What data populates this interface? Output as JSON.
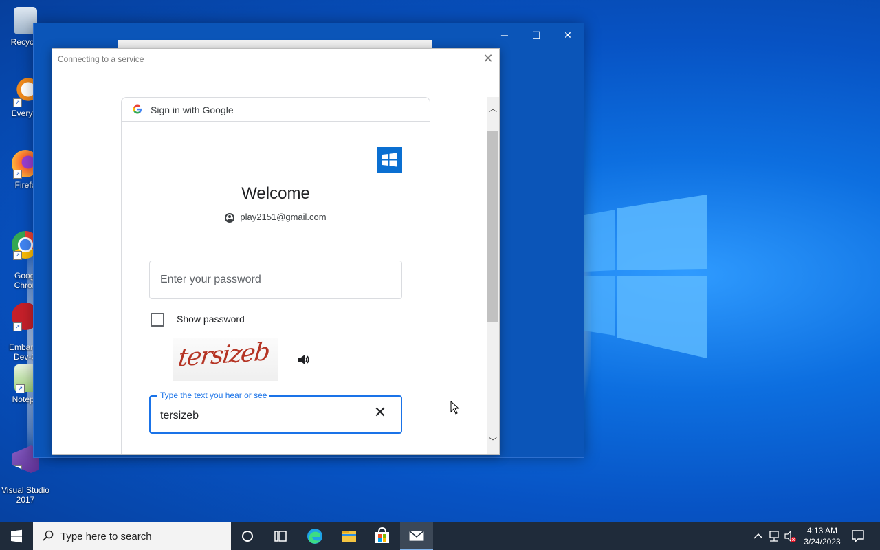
{
  "desktop": {
    "icons": [
      {
        "label": "Recycle",
        "icon": "recycle-bin-icon"
      },
      {
        "label": "Everyth",
        "icon": "everything-search-icon"
      },
      {
        "label": "Firefo",
        "icon": "firefox-icon"
      },
      {
        "label": "Googl\nChron",
        "icon": "chrome-icon"
      },
      {
        "label": "Embarca\nDev-C",
        "icon": "devcpp-icon"
      },
      {
        "label": "Notepa",
        "icon": "notepad-icon"
      },
      {
        "label": "Visual Studio\n2017",
        "icon": "visual-studio-icon"
      }
    ]
  },
  "dialog": {
    "title": "Connecting to a service",
    "google_header": "Sign in with Google",
    "welcome": "Welcome",
    "account_email": "play2151@gmail.com",
    "password_placeholder": "Enter your password",
    "show_password_label": "Show password",
    "show_password_checked": false,
    "captcha_image_text": "tersizeb",
    "captcha_field_label": "Type the text you hear or see",
    "captcha_field_value": "tersizeb"
  },
  "taskbar": {
    "search_placeholder": "Type here to search",
    "time": "4:13 AM",
    "date": "3/24/2023"
  },
  "colors": {
    "accent": "#1a73e8",
    "taskbar": "#1f2b3a",
    "captcha_text": "#b53424"
  }
}
